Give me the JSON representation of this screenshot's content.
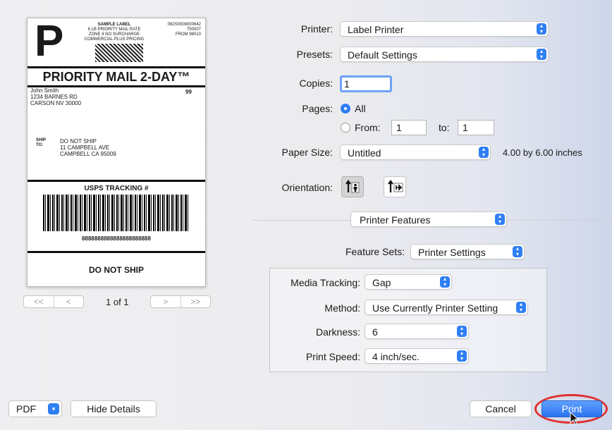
{
  "preview": {
    "label": {
      "service_letter": "P",
      "header_lines": [
        "SAMPLE LABEL",
        "6 LB PRIORITY MAIL RATE",
        "ZONE 4 NO SURCHARGE",
        "COMMERCIAL PLUS PRICING"
      ],
      "header_right": [
        "062S0008000642",
        "750007",
        "FROM 98010"
      ],
      "mail_class": "PRIORITY MAIL 2-DAY™",
      "sender": [
        "John Smith",
        "1234 BARNES RD",
        "CARSON NV 30000"
      ],
      "sender_code": "99",
      "ship_to_label": "SHIP\nTO:",
      "recipient": [
        "DO NOT SHIP",
        "11 CAMPBELL AVE",
        "CAMPBELL CA 95009"
      ],
      "tracking_title": "USPS TRACKING #",
      "tracking_number": "8888888888888888888888",
      "footer": "DO NOT SHIP"
    },
    "page_indicator": "1 of 1",
    "nav_prev": [
      "<<",
      "<"
    ],
    "nav_next": [
      ">",
      ">>"
    ]
  },
  "form": {
    "printer": {
      "label": "Printer:",
      "value": "Label Printer"
    },
    "presets": {
      "label": "Presets:",
      "value": "Default Settings"
    },
    "copies": {
      "label": "Copies:",
      "value": "1"
    },
    "pages": {
      "label": "Pages:",
      "all": "All",
      "from": "From:",
      "from_value": "1",
      "to": "to:",
      "to_value": "1"
    },
    "paper_size": {
      "label": "Paper Size:",
      "value": "Untitled",
      "dimensions": "4.00 by 6.00 inches"
    },
    "orientation": {
      "label": "Orientation:"
    },
    "section": "Printer Features",
    "feature_sets": {
      "label": "Feature Sets:",
      "value": "Printer Settings"
    },
    "settings": [
      {
        "label": "Media Tracking:",
        "value": "Gap"
      },
      {
        "label": "Method:",
        "value": "Use Currently Printer Setting"
      },
      {
        "label": "Darkness:",
        "value": "6"
      },
      {
        "label": "Print Speed:",
        "value": "4 inch/sec."
      }
    ]
  },
  "footer": {
    "pdf": "PDF",
    "hide_details": "Hide Details",
    "cancel": "Cancel",
    "print": "Print"
  },
  "colors": {
    "accent": "#2f7ff5",
    "highlight_ring": "#e03030"
  },
  "icons": [
    "chevron-updown-icon",
    "portrait-orientation-icon",
    "landscape-orientation-icon",
    "mouse-cursor-icon"
  ]
}
